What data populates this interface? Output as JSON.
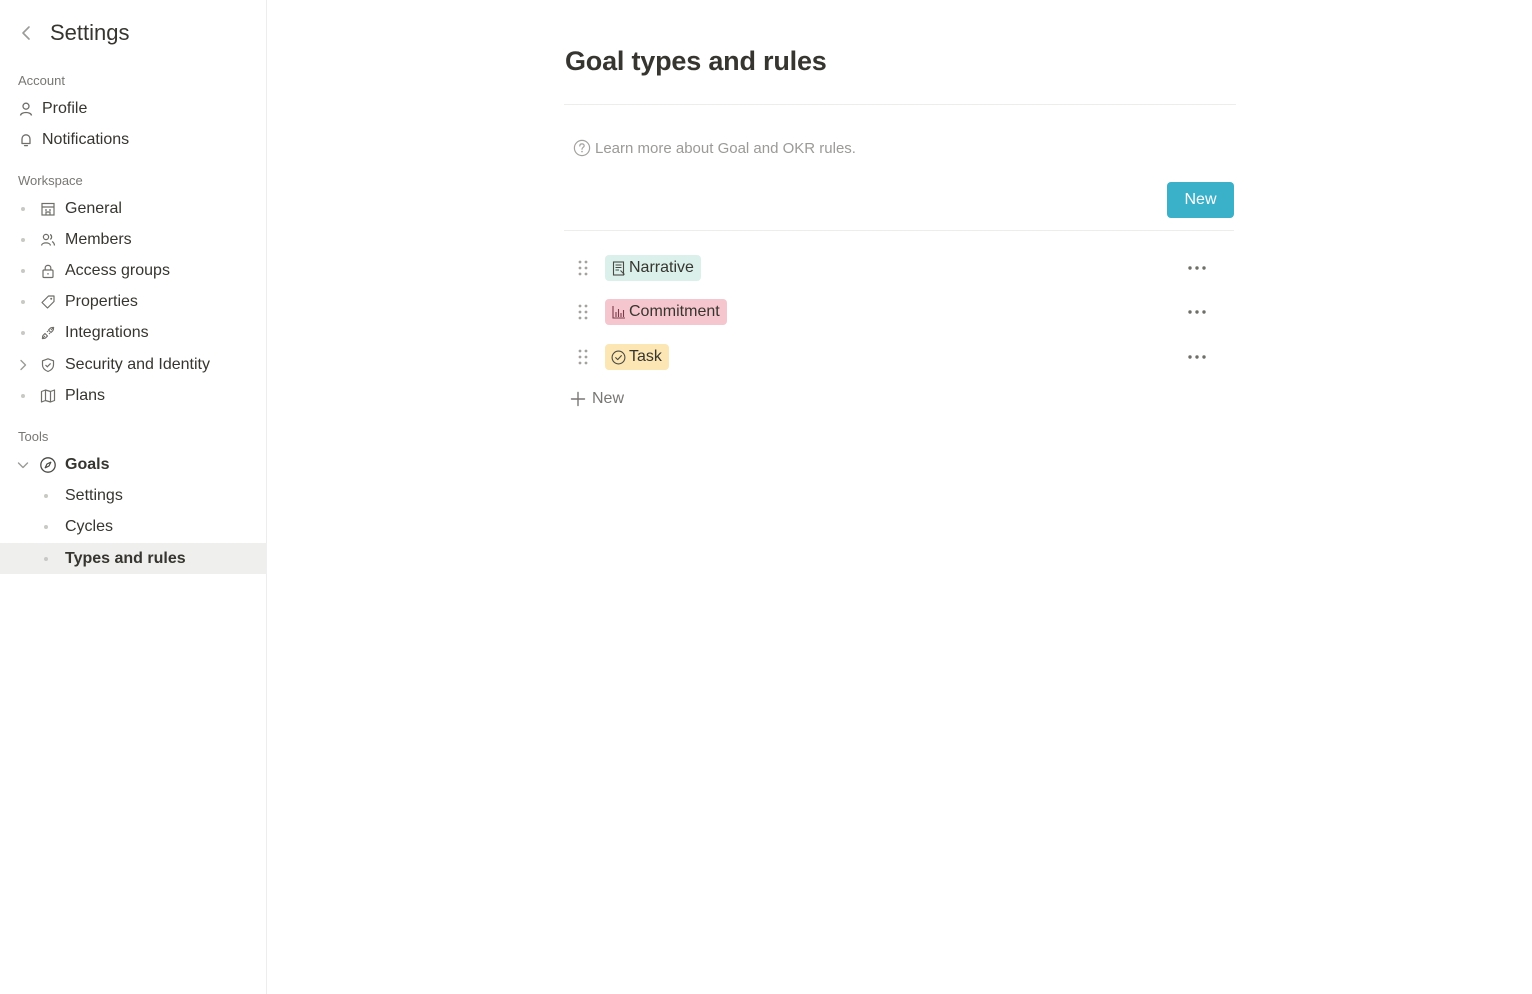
{
  "sidebar": {
    "title": "Settings",
    "sections": {
      "account": "Account",
      "workspace": "Workspace",
      "tools": "Tools"
    },
    "account_items": [
      {
        "label": "Profile",
        "icon": "person-icon"
      },
      {
        "label": "Notifications",
        "icon": "bell-icon"
      }
    ],
    "workspace_items": [
      {
        "label": "General",
        "icon": "building-icon"
      },
      {
        "label": "Members",
        "icon": "members-icon"
      },
      {
        "label": "Access groups",
        "icon": "lock-icon"
      },
      {
        "label": "Properties",
        "icon": "tag-icon"
      },
      {
        "label": "Integrations",
        "icon": "plug-icon"
      },
      {
        "label": "Security and Identity",
        "icon": "shield-icon"
      },
      {
        "label": "Plans",
        "icon": "map-icon"
      }
    ],
    "tools_items": [
      {
        "label": "Goals",
        "icon": "compass-icon"
      },
      {
        "label": "Settings"
      },
      {
        "label": "Cycles"
      },
      {
        "label": "Types and rules"
      }
    ]
  },
  "main": {
    "title": "Goal types and rules",
    "help_text": "Learn more about Goal and OKR rules.",
    "new_button": "New",
    "goal_types": [
      {
        "label": "Narrative",
        "icon": "document-icon",
        "color": "#dbf0ea"
      },
      {
        "label": "Commitment",
        "icon": "bar-chart-icon",
        "color": "#f6c6ce"
      },
      {
        "label": "Task",
        "icon": "check-circle-icon",
        "color": "#fbe6b4"
      }
    ],
    "add_new_label": "New"
  },
  "colors": {
    "accent": "#3bb0c9",
    "active_bg": "#efefee"
  }
}
